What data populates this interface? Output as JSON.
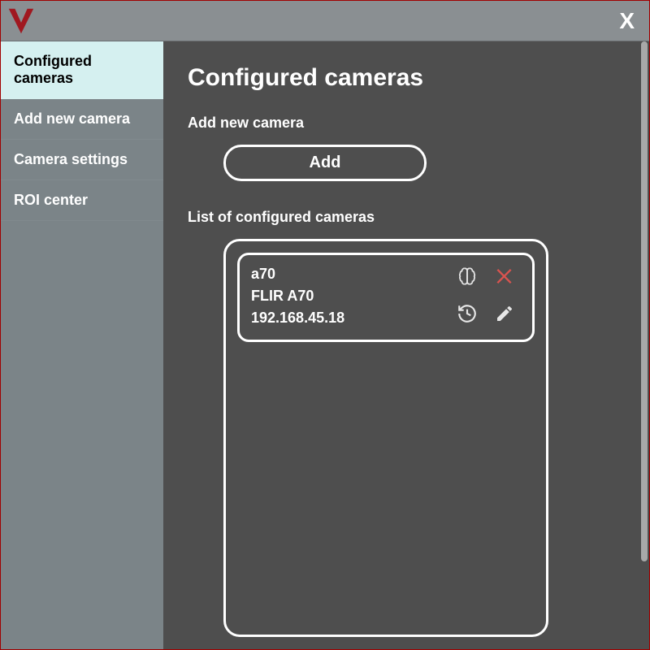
{
  "titlebar": {
    "close_label": "X"
  },
  "sidebar": {
    "items": [
      {
        "label": "Configured cameras",
        "active": true
      },
      {
        "label": "Add new camera",
        "active": false
      },
      {
        "label": "Camera settings",
        "active": false
      },
      {
        "label": "ROI center",
        "active": false
      }
    ]
  },
  "main": {
    "title": "Configured cameras",
    "add_section_label": "Add new camera",
    "add_button_label": "Add",
    "list_label": "List of configured cameras",
    "cameras": [
      {
        "name": "a70",
        "model": "FLIR A70",
        "ip": "192.168.45.18"
      }
    ]
  },
  "colors": {
    "accent_red": "#d9534f",
    "sidebar_bg": "#7b8488",
    "sidebar_active_bg": "#d5f0f0",
    "main_bg": "#4e4e4e",
    "titlebar_bg": "#8a8f92",
    "window_border": "#a00000"
  }
}
